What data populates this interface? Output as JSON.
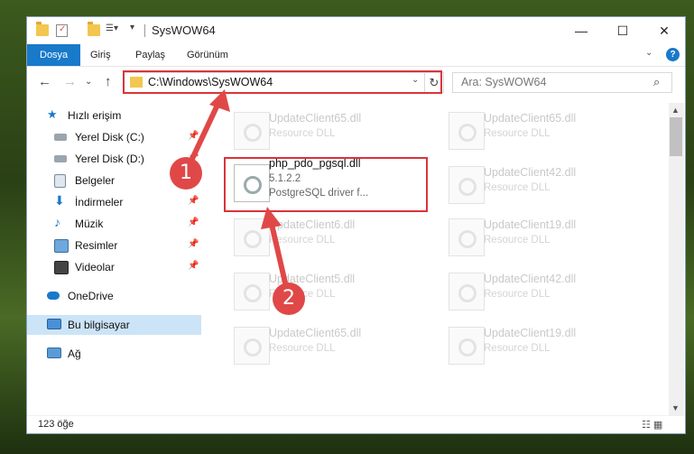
{
  "titlebar": {
    "title": "SysWOW64",
    "icons": [
      "folder-icon",
      "properties-icon",
      "new-folder-icon",
      "customize-icon"
    ],
    "minimize": "—",
    "maximize": "☐",
    "close": "✕"
  },
  "ribbon": {
    "tabs": [
      "Dosya",
      "Giriş",
      "Paylaş",
      "Görünüm"
    ],
    "help": "?"
  },
  "navigation": {
    "back": "←",
    "forward": "→",
    "up": "↑",
    "address": "C:\\Windows\\SysWOW64",
    "search_placeholder": "Ara: SysWOW64"
  },
  "sidebar": {
    "quick_access": "Hızlı erişim",
    "items": [
      {
        "label": "Yerel Disk (C:)",
        "icon": "drive-icon"
      },
      {
        "label": "Yerel Disk (D:)",
        "icon": "drive-icon"
      },
      {
        "label": "Belgeler",
        "icon": "documents-icon"
      },
      {
        "label": "İndirmeler",
        "icon": "downloads-icon"
      },
      {
        "label": "Müzik",
        "icon": "music-icon"
      },
      {
        "label": "Resimler",
        "icon": "pictures-icon"
      },
      {
        "label": "Videolar",
        "icon": "videos-icon"
      }
    ],
    "onedrive": "OneDrive",
    "this_pc": "Bu bilgisayar",
    "network": "Ağ"
  },
  "files": {
    "left_column": [
      {
        "name": "UpdateClient65.dll",
        "type": "Resource DLL"
      },
      {
        "name": "php_pdo_pgsql.dll",
        "version": "5.1.2.2",
        "description": "PostgreSQL driver f..."
      },
      {
        "name": "UpdateClient6.dll",
        "type": "Resource DLL"
      },
      {
        "name": "UpdateClient5.dll",
        "type": "Resource DLL"
      },
      {
        "name": "UpdateClient65.dll",
        "type": "Resource DLL"
      }
    ],
    "right_column": [
      {
        "name": "UpdateClient65.dll",
        "type": "Resource DLL"
      },
      {
        "name": "UpdateClient42.dll",
        "type": "Resource DLL"
      },
      {
        "name": "UpdateClient19.dll",
        "type": "Resource DLL"
      },
      {
        "name": "UpdateClient42.dll",
        "type": "Resource DLL"
      },
      {
        "name": "UpdateClient19.dll",
        "type": "Resource DLL"
      }
    ]
  },
  "status": {
    "item_count": "123 öğe"
  },
  "annotations": {
    "badge1": "1",
    "badge2": "2",
    "highlight_color": "#d9343a"
  }
}
